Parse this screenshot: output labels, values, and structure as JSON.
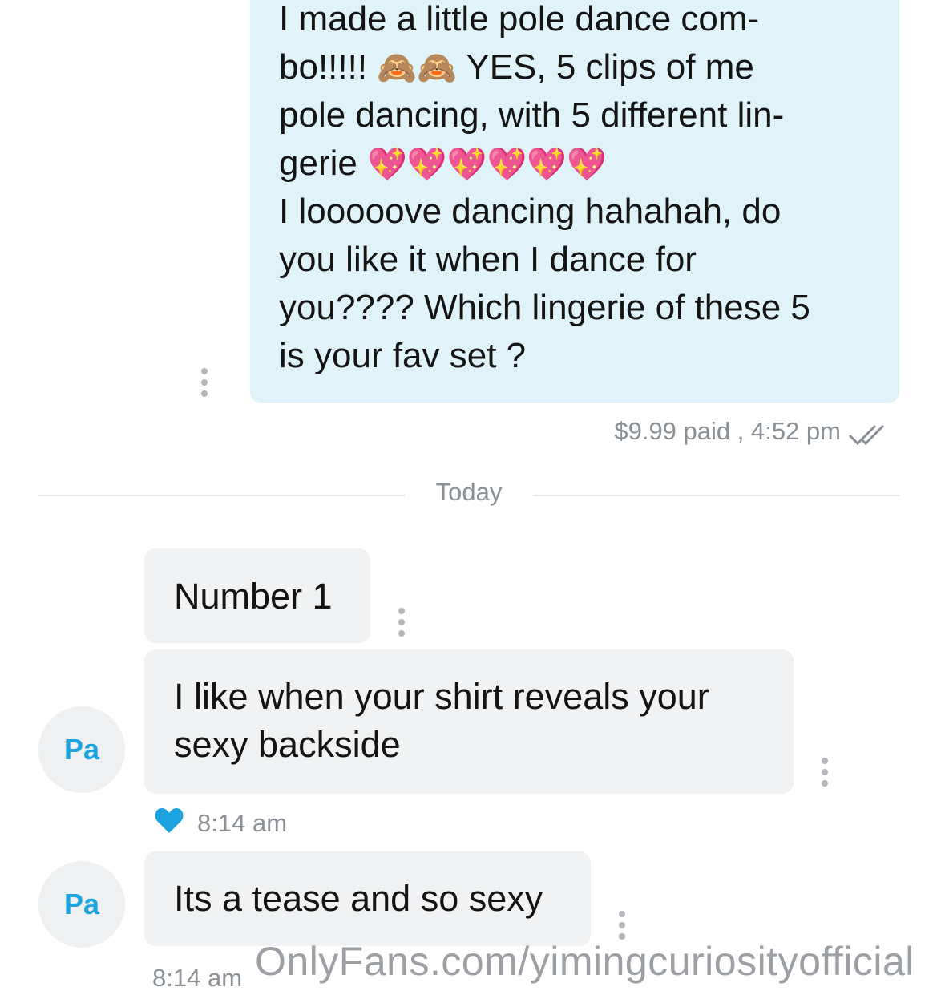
{
  "sent_message": {
    "lines": [
      {
        "text": "I made a little pole dance com-",
        "emoji": ""
      },
      {
        "text": "bo!!!!!",
        "emoji": "🙈🙈",
        "after": "YES, 5 clips of me"
      },
      {
        "text": "pole dancing, with 5 different lin-",
        "emoji": ""
      },
      {
        "text": "gerie",
        "emoji": "💖💖💖💖💖💖"
      },
      {
        "text": "I looooove dancing hahahah, do",
        "emoji": ""
      },
      {
        "text": "you like it when I dance for",
        "emoji": ""
      },
      {
        "text": "you???? Which lingerie of these 5",
        "emoji": ""
      },
      {
        "text": "is your fav set ?",
        "emoji": ""
      }
    ],
    "meta": "$9.99 paid , 4:52 pm",
    "status_icon": "double-check-icon"
  },
  "divider": {
    "label": "Today"
  },
  "received_messages": [
    {
      "text": "Number 1"
    },
    {
      "line1": "I like when your shirt reveals your",
      "line2": "sexy backside",
      "avatar": "Pa",
      "time": "8:14 am",
      "liked": true
    },
    {
      "text": "Its a tease and so sexy",
      "avatar": "Pa",
      "time": "8:14 am"
    }
  ],
  "watermark": "OnlyFans.com/yimingcuriosityofficial",
  "colors": {
    "sent_bubble": "#dff3f9",
    "received_bubble": "#f0f2f3",
    "accent": "#1aa3df",
    "meta_text": "#8a9096"
  }
}
